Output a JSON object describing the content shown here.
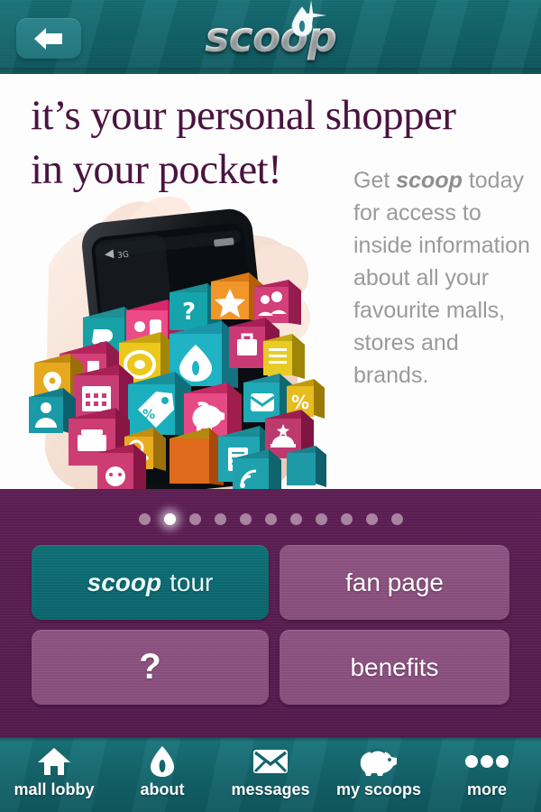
{
  "header": {
    "back_label": "back",
    "back_icon": "arrow-left-icon",
    "logo_text": "scoop"
  },
  "hero": {
    "headline": "it’s your personal shopper\nin your pocket!",
    "body_lead": "Get ",
    "body_brand": "scoop",
    "body_rest": " today for access to inside information about all your favourite malls, stores and brands.",
    "illustration_name": "hand-holding-phone-with-app-icons"
  },
  "panel": {
    "pagination": {
      "total": 11,
      "active_index": 1
    },
    "buttons": [
      {
        "id": "scoop-tour",
        "emphasis": "scoop",
        "label": "tour",
        "style": "teal"
      },
      {
        "id": "fan-page",
        "emphasis": "",
        "label": "fan page",
        "style": "purple"
      },
      {
        "id": "help",
        "emphasis": "",
        "label": "?",
        "style": "purple"
      },
      {
        "id": "benefits",
        "emphasis": "",
        "label": "benefits",
        "style": "purple"
      }
    ]
  },
  "nav": {
    "items": [
      {
        "label": "mall lobby",
        "icon": "home-icon"
      },
      {
        "label": "about",
        "icon": "droplet-icon"
      },
      {
        "label": "messages",
        "icon": "envelope-icon"
      },
      {
        "label": "my scoops",
        "icon": "piggy-bank-icon"
      },
      {
        "label": "more",
        "icon": "ellipsis-icon"
      }
    ]
  },
  "colors": {
    "teal_header": "#12676e",
    "teal_button": "#0d6a70",
    "purple_panel": "#5e1f55",
    "purple_button": "#8c5080",
    "headline": "#4a1340",
    "body_text": "#9a9a9a",
    "white": "#ffffff"
  }
}
